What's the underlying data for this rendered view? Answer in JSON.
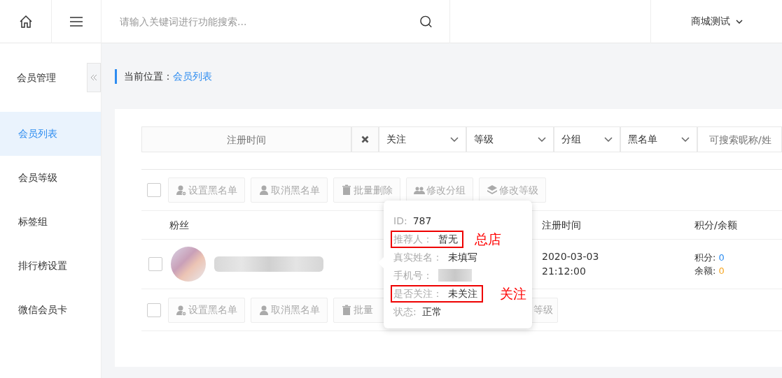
{
  "topbar": {
    "search": {
      "placeholder": "请输入关键词进行功能搜索..."
    },
    "store": "商城测试"
  },
  "sidebar": {
    "title": "会员管理",
    "items": [
      {
        "label": "会员列表",
        "selected": true
      },
      {
        "label": "会员等级",
        "selected": false
      },
      {
        "label": "标签组",
        "selected": false
      },
      {
        "label": "排行榜设置",
        "selected": false
      },
      {
        "label": "微信会员卡",
        "selected": false
      }
    ]
  },
  "breadcrumb": {
    "label": "当前位置：",
    "current": "会员列表"
  },
  "filters": {
    "date": {
      "placeholder": "注册时间"
    },
    "selects": [
      "关注",
      "等级",
      "分组",
      "黑名单"
    ],
    "search": {
      "placeholder": "可搜索昵称/姓"
    }
  },
  "toolbar": {
    "checked": false,
    "buttons": [
      {
        "label": "设置黑名单",
        "kind": "block"
      },
      {
        "label": "取消黑名单",
        "kind": "unblock"
      },
      {
        "label": "批量删除",
        "kind": "delete"
      },
      {
        "label": "修改分组",
        "kind": "group"
      },
      {
        "label": "修改等级",
        "kind": "level"
      }
    ]
  },
  "table": {
    "columns": [
      "粉丝",
      "注册时间",
      "积分/余额"
    ],
    "rows": [
      {
        "checked": false,
        "date": "2020-03-03",
        "time": "21:12:00",
        "points_label": "积分:",
        "points": "0",
        "balance_label": "余额:",
        "balance": "0"
      }
    ]
  },
  "bottom_toolbar": {
    "checked": false,
    "buttons": [
      {
        "label": "设置黑名单",
        "kind": "block"
      },
      {
        "label": "取消黑名单",
        "kind": "unblock"
      },
      {
        "label": "批量",
        "kind": "delete"
      },
      {
        "label": "等级"
      }
    ]
  },
  "popover": {
    "fields": [
      {
        "label": "ID:",
        "value": "787",
        "highlighted": false
      },
      {
        "label": "推荐人：",
        "value": "暂无",
        "highlighted": true,
        "note": "总店"
      },
      {
        "label": "真实姓名：",
        "value": "未填写",
        "highlighted": false
      },
      {
        "label": "手机号：",
        "redacted": true,
        "highlighted": false
      },
      {
        "label": "是否关注：",
        "value": "未关注",
        "highlighted": true,
        "note": "关注"
      },
      {
        "label": "状态:",
        "value": "正常",
        "highlighted": false
      }
    ]
  }
}
